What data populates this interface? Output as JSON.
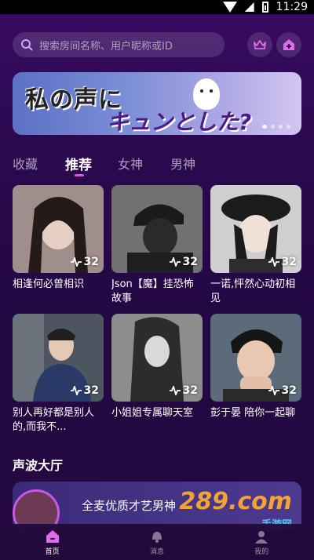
{
  "status_bar": {
    "time": "11:29"
  },
  "search": {
    "placeholder": "搜索房间名称、用户昵称或ID"
  },
  "banner": {
    "line1": "私の声に",
    "line2": "キュンとした?",
    "dot_count": 4
  },
  "tabs": [
    {
      "label": "收藏",
      "active": false
    },
    {
      "label": "推荐",
      "active": true
    },
    {
      "label": "女神",
      "active": false
    },
    {
      "label": "男神",
      "active": false
    }
  ],
  "rooms": [
    {
      "title": "相逢何必曾相识",
      "count": "32"
    },
    {
      "title": "Json【魔】挂恐怖故事",
      "count": "32"
    },
    {
      "title": "一诺,怦然心动初相见",
      "count": "32"
    },
    {
      "title": "别人再好都是别人的,而我不...",
      "count": "32"
    },
    {
      "title": "小姐姐专属聊天室",
      "count": "32"
    },
    {
      "title": "彭于晏 陪你一起聊",
      "count": "32"
    }
  ],
  "section": {
    "title": "声波大厅"
  },
  "hall": {
    "text": "全麦优质才艺男神",
    "watermark": "289.com",
    "watermark_sub": "手游网"
  },
  "bottom_nav": [
    {
      "label": "首页",
      "icon": "home-icon",
      "active": true
    },
    {
      "label": "消息",
      "icon": "message-icon",
      "active": false
    },
    {
      "label": "我的",
      "icon": "profile-icon",
      "active": false
    }
  ],
  "colors": {
    "accent": "#d35bd9",
    "background": "#2b0950"
  }
}
